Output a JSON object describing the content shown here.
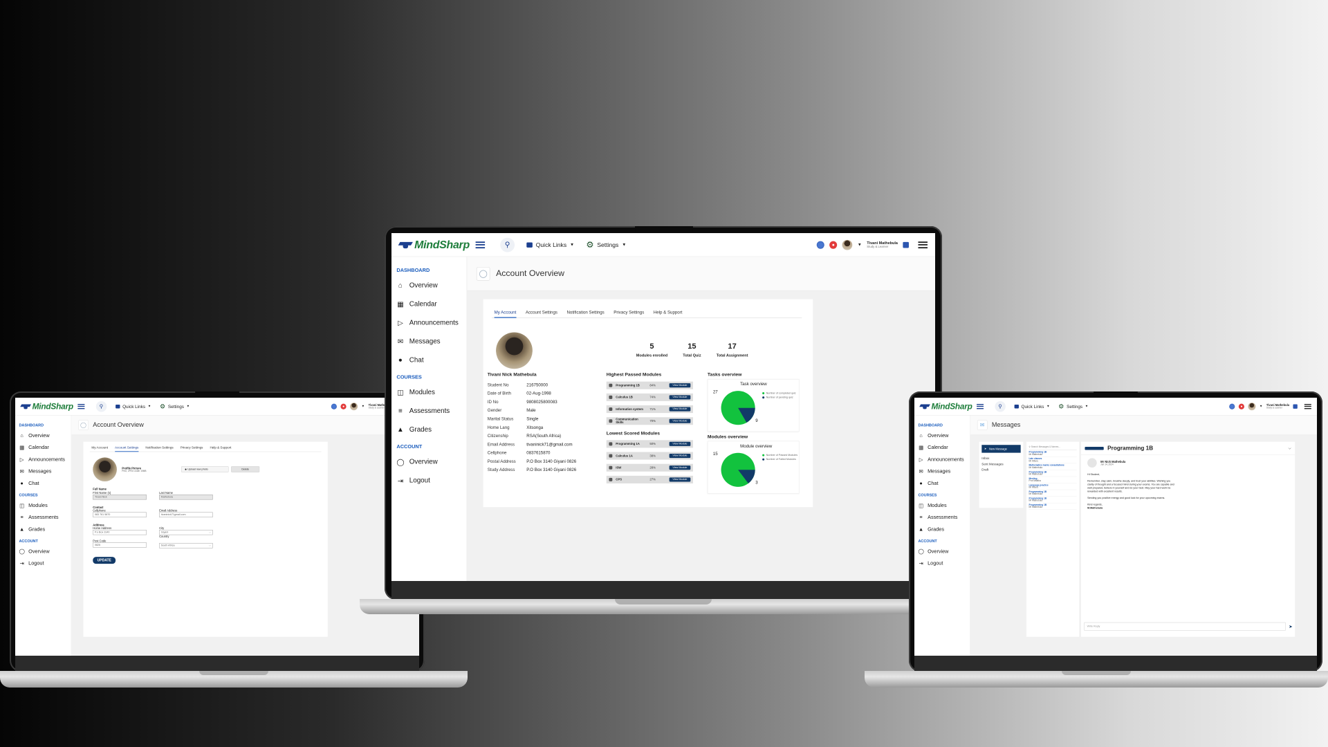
{
  "app": {
    "brand": "MindSharp",
    "topbar": {
      "quick_links": "Quick Links",
      "settings": "Settings",
      "user_name": "Tivani Mathebula",
      "user_role": "Study & Learner"
    },
    "sidebar": {
      "dashboard_title": "DASHBOARD",
      "dashboard_items": [
        "Overview",
        "Calendar",
        "Announcements",
        "Messages",
        "Chat"
      ],
      "courses_title": "COURSES",
      "courses_items": [
        "Modules",
        "Assessments",
        "Grades"
      ],
      "account_title": "ACCOUNT",
      "account_items": [
        "Overview",
        "Logout"
      ]
    }
  },
  "center": {
    "page_title": "Account Overview",
    "tabs": [
      "My Account",
      "Account Settings",
      "Notification Settings",
      "Privacy Settings",
      "Help & Support"
    ],
    "profile_name": "Tivani Nick Mathebula",
    "info": [
      {
        "k": "Student No",
        "v": "216750000"
      },
      {
        "k": "Date of Birth",
        "v": "02-Aug-1998"
      },
      {
        "k": "ID No",
        "v": "9808025800083"
      },
      {
        "k": "Gender",
        "v": "Male"
      },
      {
        "k": "Marital Status",
        "v": "Single"
      },
      {
        "k": "Home Lang",
        "v": "Xitsonga"
      },
      {
        "k": "Citizenship",
        "v": "RSA(South Africa)"
      },
      {
        "k": "Email Address",
        "v": "tivaninick71@gmail.com"
      },
      {
        "k": "Cellphone",
        "v": "0837615870"
      },
      {
        "k": "Postal Address",
        "v": "P.O Box 3140 Giyani 0826"
      },
      {
        "k": "Study Address",
        "v": "P.O Box 3140 Giyani 0826"
      }
    ],
    "stats": [
      {
        "n": "5",
        "l": "Modules enrolled"
      },
      {
        "n": "15",
        "l": "Total Quiz"
      },
      {
        "n": "17",
        "l": "Total Assignment"
      }
    ],
    "highest_title": "Highest Passed Modules",
    "highest": [
      {
        "name": "Programming 1B",
        "pct": "84%"
      },
      {
        "name": "Calculus 1B",
        "pct": "74%"
      },
      {
        "name": "Information system",
        "pct": "71%"
      },
      {
        "name": "Communication Skills",
        "pct": "70%"
      }
    ],
    "lowest_title": "Lowest Scored Modules",
    "lowest": [
      {
        "name": "Programming 1A",
        "pct": "50%"
      },
      {
        "name": "Calculus 1A",
        "pct": "38%"
      },
      {
        "name": "ISW",
        "pct": "28%"
      },
      {
        "name": "CPS",
        "pct": "27%"
      }
    ],
    "view_label": "View Module",
    "tasks_title": "Tasks overview",
    "task_chart_title": "Task overview",
    "task_values": {
      "a": "27",
      "b": "9"
    },
    "task_legend": [
      "Number of completed quiz",
      "Number of pending quiz"
    ],
    "modules_title": "Modules overview",
    "module_chart_title": "Module overview",
    "module_values": {
      "a": "15",
      "b": "3"
    },
    "module_legend": [
      "Number of Passed Modules",
      "Number of Failed Modules"
    ]
  },
  "left": {
    "page_title": "Account Overview",
    "tabs": [
      "My Account",
      "Account Settings",
      "Notification Settings",
      "Privacy Settings",
      "Help & Support"
    ],
    "profile_picture": "Profile Picture",
    "profile_hint": "PNG, JPEG under 15MB",
    "upload": "Upload new photo",
    "delete": "Delete",
    "full_name": "Full Name",
    "first_name_label": "First Name (s)",
    "first_name": "Tivani Nick",
    "last_name_label": "Last Name",
    "last_name": "Mathebula",
    "contact": "Contact",
    "cell_label": "Cellphone",
    "cell": "083 761 5870",
    "email_label": "Email Address",
    "email": "tivaninick71gmail.com",
    "address": "Address",
    "home_label": "Home Address",
    "home": "P.o Box 3140",
    "city_label": "City",
    "city": "Giyani",
    "country_label": "Country",
    "postcode_label": "Post Code",
    "postcode": "0826",
    "country": "South Africa",
    "update": "UPDATE"
  },
  "right": {
    "page_title": "Messages",
    "new_message": "New Message",
    "folders": [
      "Inbox",
      "Sent Messages",
      "Draft"
    ],
    "search_placeholder": "Search Messages & Names...",
    "list": [
      {
        "t": "Programming 1B",
        "s": "Mr Mathebula"
      },
      {
        "t": "Late classes",
        "s": "Mr Mburu"
      },
      {
        "t": "Mathematics marks consultations",
        "s": "Mr Mathebula"
      },
      {
        "t": "Programming 1B",
        "s": "Mr Mathebula"
      },
      {
        "t": "Meeting",
        "s": "Prof Mbatha"
      },
      {
        "t": "Language practice",
        "s": "Mr Mburu"
      },
      {
        "t": "Programming 1B",
        "s": "Mr Mathebula"
      },
      {
        "t": "Programming 1B",
        "s": "Mr Mathebula"
      },
      {
        "t": "Programming 1B",
        "s": "Mr Mathebula"
      }
    ],
    "thread_title": "Programming 1B",
    "sender": "Mr Nick Mathebula",
    "date": "Jun 14, 2024",
    "greeting": "Hi Student,",
    "body": "Remember, stay calm, breathe deeply, and trust your abilities. Wishing you clarity of thought and a focused mind during your exams. You are capable and well-prepared, believe in yourself and do your best. May your hard work be rewarded with excellent results.",
    "body2": "Sending you positive energy and good luck for your upcoming exams.",
    "signoff": "Kind regards,",
    "signname": "M.Mathebula",
    "reply_placeholder": "Write Reply"
  }
}
